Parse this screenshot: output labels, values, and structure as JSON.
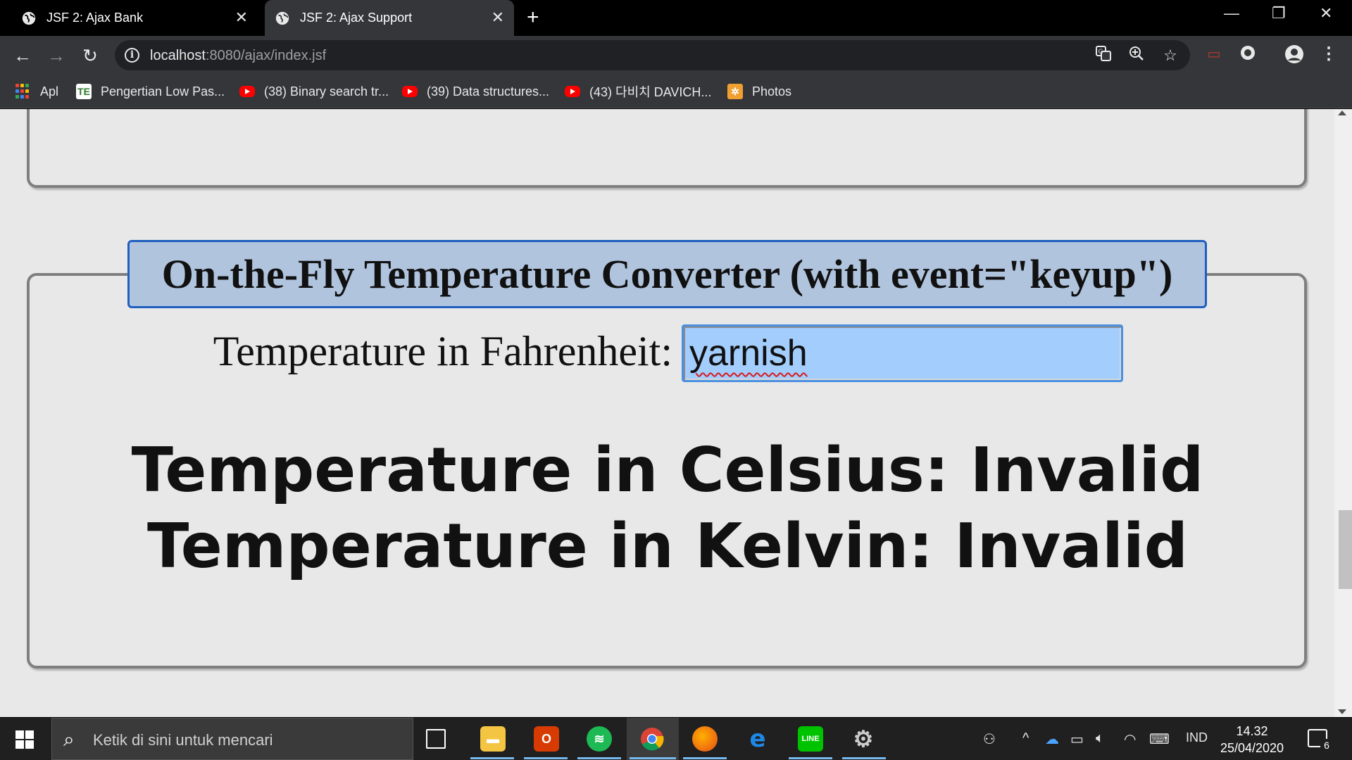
{
  "browser": {
    "tabs": [
      {
        "title": "JSF 2: Ajax Bank",
        "active": false
      },
      {
        "title": "JSF 2: Ajax Support",
        "active": true
      }
    ],
    "new_tab_symbol": "+",
    "window_controls": {
      "minimize": "—",
      "restore": "❐",
      "close": "✕"
    },
    "address": {
      "host": "localhost",
      "rest": ":8080/ajax/index.jsf"
    },
    "nav": {
      "back": "←",
      "forward": "→",
      "reload": "↻"
    },
    "bookmarks": [
      {
        "label": "Apl",
        "icon": "apps-grid-icon"
      },
      {
        "label": "Pengertian Low Pas...",
        "icon": "site-icon"
      },
      {
        "label": "(38) Binary search tr...",
        "icon": "youtube-icon"
      },
      {
        "label": "(39) Data structures...",
        "icon": "youtube-icon"
      },
      {
        "label": "(43) 다비치 DAVICH...",
        "icon": "youtube-icon"
      },
      {
        "label": "Photos",
        "icon": "photos-icon"
      }
    ]
  },
  "page": {
    "legend": "On-the-Fly Temperature Converter (with event=\"keyup\")",
    "fahrenheit_label": "Temperature in Fahrenheit:",
    "fahrenheit_value": "yarnish",
    "celsius_result": "Temperature in Celsius: Invalid",
    "kelvin_result": "Temperature in Kelvin: Invalid",
    "colors": {
      "legend_bg": "#b0c4de",
      "legend_border": "#1f5fbf",
      "input_bg": "#a2cdfd",
      "page_bg": "#e8e8e8"
    }
  },
  "taskbar": {
    "search_placeholder": "Ketik di sini untuk mencari",
    "language": "IND",
    "time": "14.32",
    "date": "25/04/2020",
    "notification_count": "6"
  }
}
